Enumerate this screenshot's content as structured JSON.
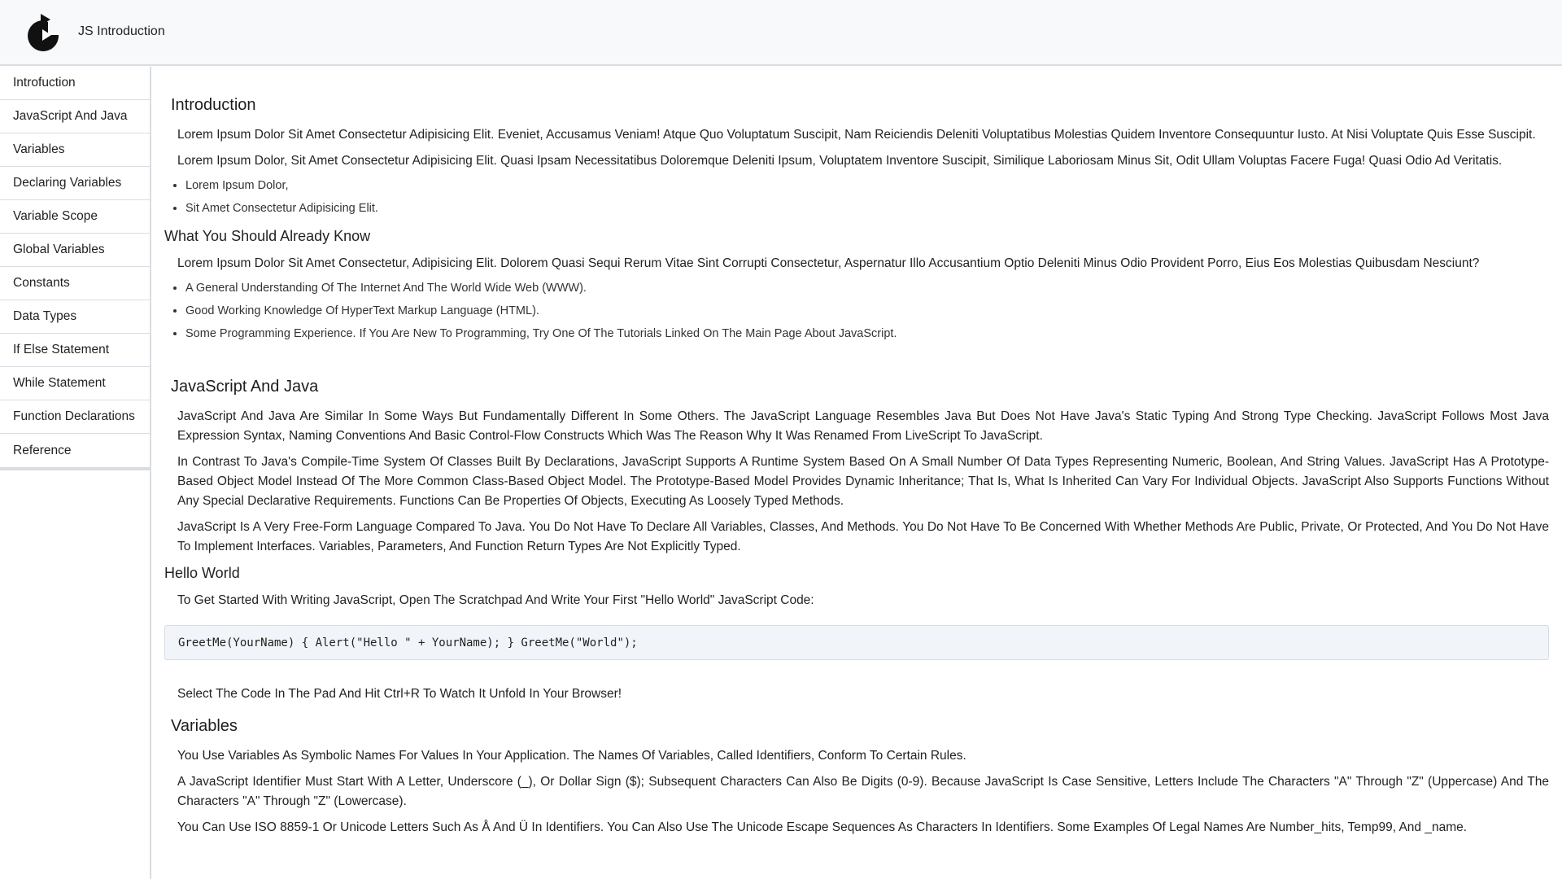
{
  "header": {
    "title": "JS Introduction",
    "logo_icon": "js-logo-icon"
  },
  "sidebar": {
    "items": [
      {
        "label": "Introfuction"
      },
      {
        "label": "JavaScript And Java"
      },
      {
        "label": "Variables"
      },
      {
        "label": "Declaring Variables"
      },
      {
        "label": "Variable Scope"
      },
      {
        "label": "Global Variables"
      },
      {
        "label": "Constants"
      },
      {
        "label": "Data Types"
      },
      {
        "label": "If Else Statement"
      },
      {
        "label": "While Statement"
      },
      {
        "label": "Function Declarations"
      },
      {
        "label": "Reference"
      }
    ]
  },
  "content": {
    "intro": {
      "heading": "Introduction",
      "p1": "Lorem Ipsum Dolor Sit Amet Consectetur Adipisicing Elit. Eveniet, Accusamus Veniam! Atque Quo Voluptatum Suscipit, Nam Reiciendis Deleniti Voluptatibus Molestias Quidem Inventore Consequuntur Iusto. At Nisi Voluptate Quis Esse Suscipit.",
      "p2": "Lorem Ipsum Dolor, Sit Amet Consectetur Adipisicing Elit. Quasi Ipsam Necessitatibus Doloremque Deleniti Ipsum, Voluptatem Inventore Suscipit, Similique Laboriosam Minus Sit, Odit Ullam Voluptas Facere Fuga! Quasi Odio Ad Veritatis.",
      "bullets": [
        "Lorem Ipsum Dolor,",
        "Sit Amet Consectetur Adipisicing Elit."
      ]
    },
    "know": {
      "heading": "What You Should Already Know",
      "p1": "Lorem Ipsum Dolor Sit Amet Consectetur, Adipisicing Elit. Dolorem Quasi Sequi Rerum Vitae Sint Corrupti Consectetur, Aspernatur Illo Accusantium Optio Deleniti Minus Odio Provident Porro, Eius Eos Molestias Quibusdam Nesciunt?",
      "bullets": [
        "A General Understanding Of The Internet And The World Wide Web (WWW).",
        "Good Working Knowledge Of HyperText Markup Language (HTML).",
        "Some Programming Experience. If You Are New To Programming, Try One Of The Tutorials Linked On The Main Page About JavaScript."
      ]
    },
    "jsjava": {
      "heading": "JavaScript And Java",
      "p1": "JavaScript And Java Are Similar In Some Ways But Fundamentally Different In Some Others. The JavaScript Language Resembles Java But Does Not Have Java's Static Typing And Strong Type Checking. JavaScript Follows Most Java Expression Syntax, Naming Conventions And Basic Control-Flow Constructs Which Was The Reason Why It Was Renamed From LiveScript To JavaScript.",
      "p2": "In Contrast To Java's Compile-Time System Of Classes Built By Declarations, JavaScript Supports A Runtime System Based On A Small Number Of Data Types Representing Numeric, Boolean, And String Values. JavaScript Has A Prototype-Based Object Model Instead Of The More Common Class-Based Object Model. The Prototype-Based Model Provides Dynamic Inheritance; That Is, What Is Inherited Can Vary For Individual Objects. JavaScript Also Supports Functions Without Any Special Declarative Requirements. Functions Can Be Properties Of Objects, Executing As Loosely Typed Methods.",
      "p3": "JavaScript Is A Very Free-Form Language Compared To Java. You Do Not Have To Declare All Variables, Classes, And Methods. You Do Not Have To Be Concerned With Whether Methods Are Public, Private, Or Protected, And You Do Not Have To Implement Interfaces. Variables, Parameters, And Function Return Types Are Not Explicitly Typed."
    },
    "hello": {
      "heading": "Hello World",
      "p1": "To Get Started With Writing JavaScript, Open The Scratchpad And Write Your First \"Hello World\" JavaScript Code:",
      "code": "GreetMe(YourName) { Alert(\"Hello \" + YourName); } GreetMe(\"World\");",
      "p2": "Select The Code In The Pad And Hit Ctrl+R To Watch It Unfold In Your Browser!"
    },
    "variables": {
      "heading": "Variables",
      "p1": "You Use Variables As Symbolic Names For Values In Your Application. The Names Of Variables, Called Identifiers, Conform To Certain Rules.",
      "p2": "A JavaScript Identifier Must Start With A Letter, Underscore (_), Or Dollar Sign ($); Subsequent Characters Can Also Be Digits (0-9). Because JavaScript Is Case Sensitive, Letters Include The Characters \"A\" Through \"Z\" (Uppercase) And The Characters \"A\" Through \"Z\" (Lowercase).",
      "p3": "You Can Use ISO 8859-1 Or Unicode Letters Such As Å And Ü In Identifiers. You Can Also Use The Unicode Escape Sequences As Characters In Identifiers. Some Examples Of Legal Names Are Number_hits, Temp99, And _name."
    }
  }
}
